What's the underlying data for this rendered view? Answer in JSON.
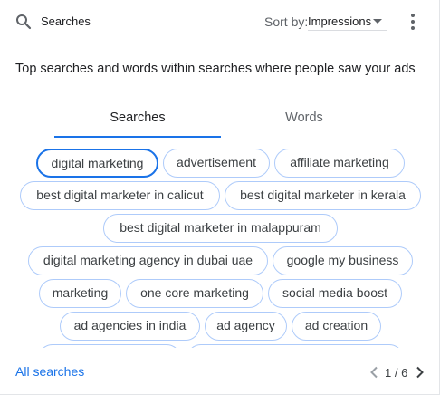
{
  "header": {
    "title": "Searches",
    "sort_label": "Sort by:",
    "sort_value": "Impressions"
  },
  "description": "Top searches and words within searches where people saw your ads",
  "tabs": [
    {
      "label": "Searches",
      "active": true
    },
    {
      "label": "Words",
      "active": false
    }
  ],
  "chips": [
    "digital marketing",
    "advertisement",
    "affiliate marketing",
    "best digital marketer in calicut",
    "best digital marketer in kerala",
    "best digital marketer in malappuram",
    "digital marketing agency in dubai uae",
    "google my business",
    "marketing",
    "one core marketing",
    "social media boost",
    "ad agencies in india",
    "ad agency",
    "ad creation"
  ],
  "selected_chip": "digital marketing",
  "footer": {
    "link": "All searches",
    "page": "1 / 6"
  },
  "colors": {
    "accent": "#1a73e8",
    "chip_border": "#aecbfa"
  },
  "icons": {
    "search": "search-icon",
    "caret": "caret-down-icon",
    "more": "more-vert-icon",
    "prev": "chevron-left-icon",
    "next": "chevron-right-icon"
  }
}
